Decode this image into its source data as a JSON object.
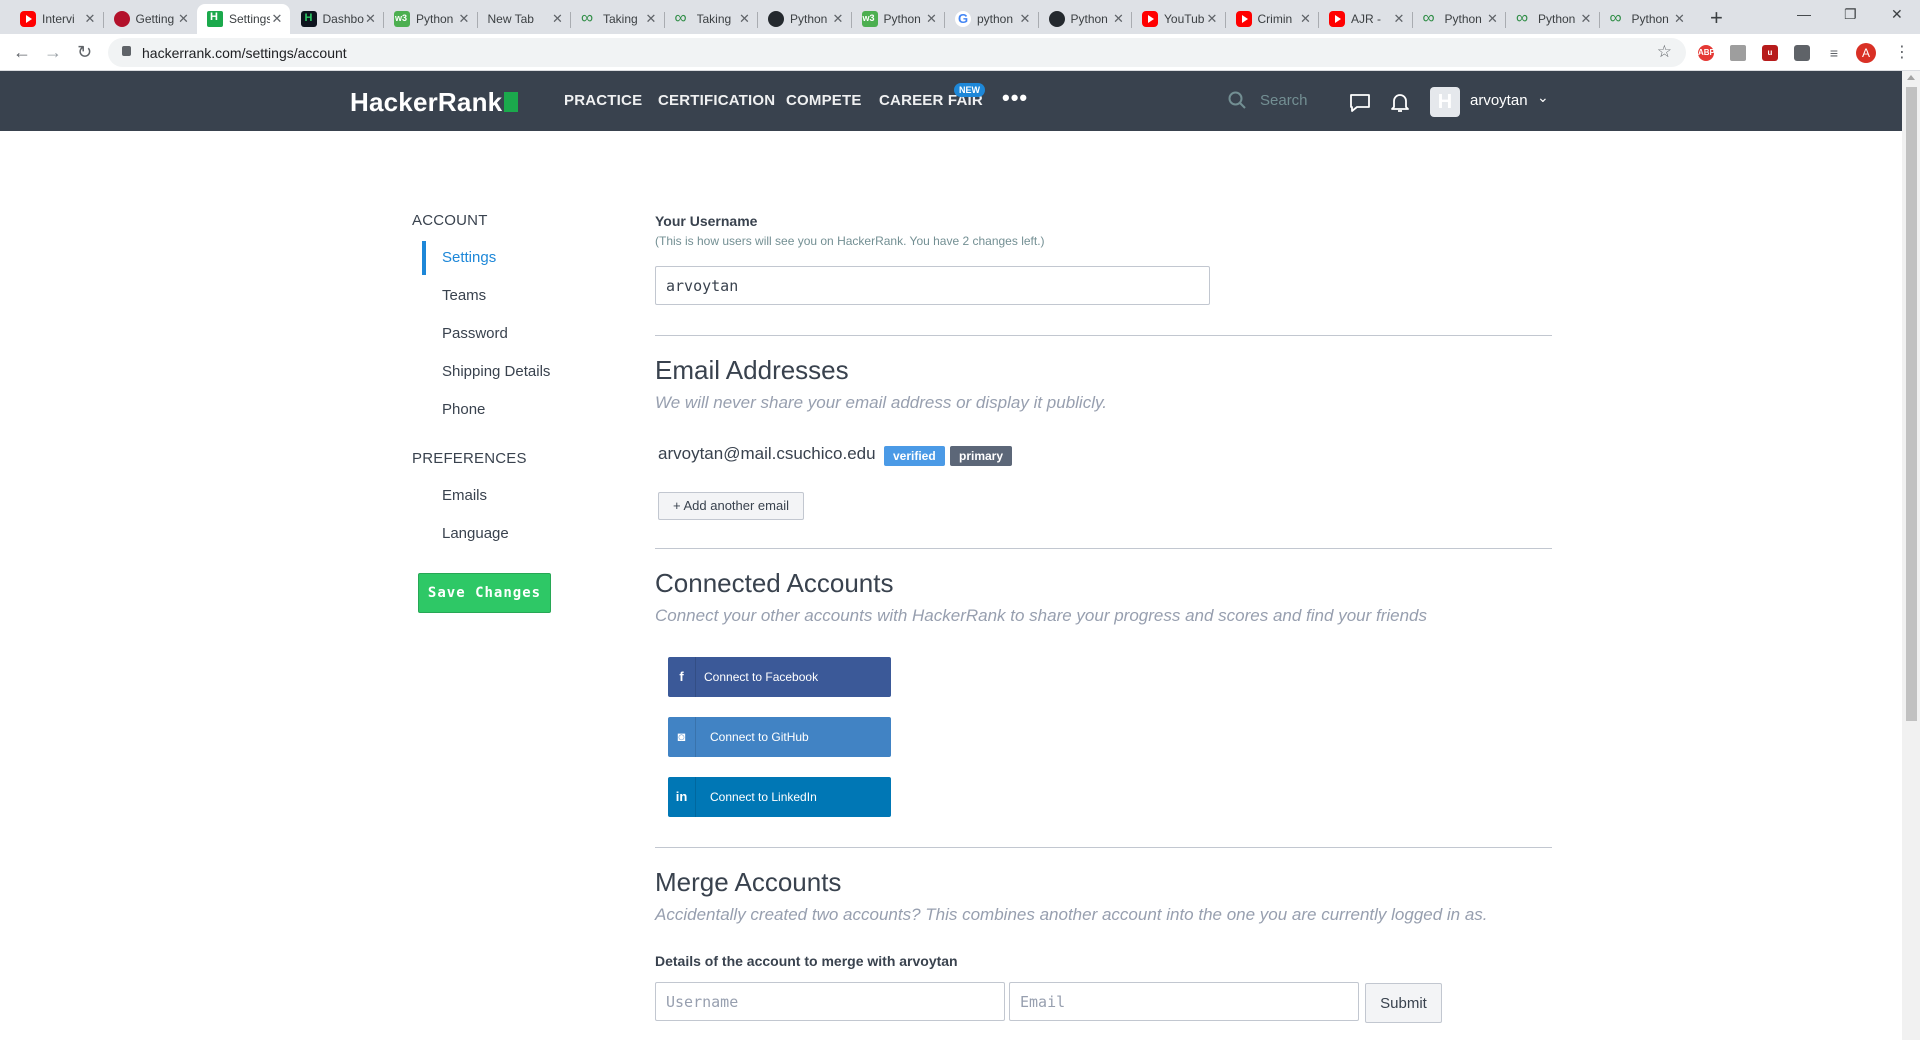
{
  "browser": {
    "tabs": [
      {
        "label": "Intervi",
        "icon": "youtube"
      },
      {
        "label": "Getting",
        "icon": "getting"
      },
      {
        "label": "Settings",
        "icon": "hr",
        "active": true
      },
      {
        "label": "Dashbo",
        "icon": "hrdark"
      },
      {
        "label": "Python",
        "icon": "w3"
      },
      {
        "label": "New Tab",
        "icon": "none"
      },
      {
        "label": "Taking",
        "icon": "gfg"
      },
      {
        "label": "Taking",
        "icon": "gfg"
      },
      {
        "label": "Python",
        "icon": "gh"
      },
      {
        "label": "Python",
        "icon": "w3"
      },
      {
        "label": "python",
        "icon": "google"
      },
      {
        "label": "Python",
        "icon": "gh"
      },
      {
        "label": "YouTub",
        "icon": "youtube"
      },
      {
        "label": "Crimin",
        "icon": "youtube"
      },
      {
        "label": "AJR -",
        "icon": "youtube"
      },
      {
        "label": "Python",
        "icon": "gfg"
      },
      {
        "label": "Python",
        "icon": "gfg"
      },
      {
        "label": "Python",
        "icon": "gfg"
      }
    ],
    "url": "hackerrank.com/settings/account",
    "profile_initial": "A"
  },
  "header": {
    "logo": "HackerRank",
    "nav": [
      "PRACTICE",
      "CERTIFICATION",
      "COMPETE",
      "CAREER FAIR"
    ],
    "new_badge": "NEW",
    "more": "•••",
    "search_placeholder": "Search",
    "avatar_letter": "H",
    "username": "arvoytan"
  },
  "sidebar": {
    "account_heading": "ACCOUNT",
    "account_items": [
      "Settings",
      "Teams",
      "Password",
      "Shipping Details",
      "Phone"
    ],
    "preferences_heading": "PREFERENCES",
    "preference_items": [
      "Emails",
      "Language"
    ],
    "save_label": "Save Changes"
  },
  "username_section": {
    "label": "Your Username",
    "hint": "(This is how users will see you on HackerRank. You have 2 changes left.)",
    "value": "arvoytan"
  },
  "email_section": {
    "title": "Email Addresses",
    "description": "We will never share your email address or display it publicly.",
    "email": "arvoytan@mail.csuchico.edu",
    "verified_badge": "verified",
    "primary_badge": "primary",
    "add_label": "+ Add another email"
  },
  "connected_section": {
    "title": "Connected Accounts",
    "description": "Connect your other accounts with HackerRank to share your progress and scores and find your friends",
    "facebook": "Connect to Facebook",
    "github": "Connect to GitHub",
    "linkedin": "Connect to LinkedIn"
  },
  "merge_section": {
    "title": "Merge Accounts",
    "description": "Accidentally created two accounts? This combines another account into the one you are currently logged in as.",
    "details_label": "Details of the account to merge with arvoytan",
    "username_placeholder": "Username",
    "email_placeholder": "Email",
    "submit_label": "Submit"
  },
  "colors": {
    "nav_bg": "#39424e",
    "accent_blue": "#1d87d8",
    "save_green": "#2ec866",
    "verified": "#4b9ae6",
    "primary": "#5c6778",
    "facebook": "#3b5998",
    "github": "#4183c4",
    "linkedin": "#0077b5"
  }
}
